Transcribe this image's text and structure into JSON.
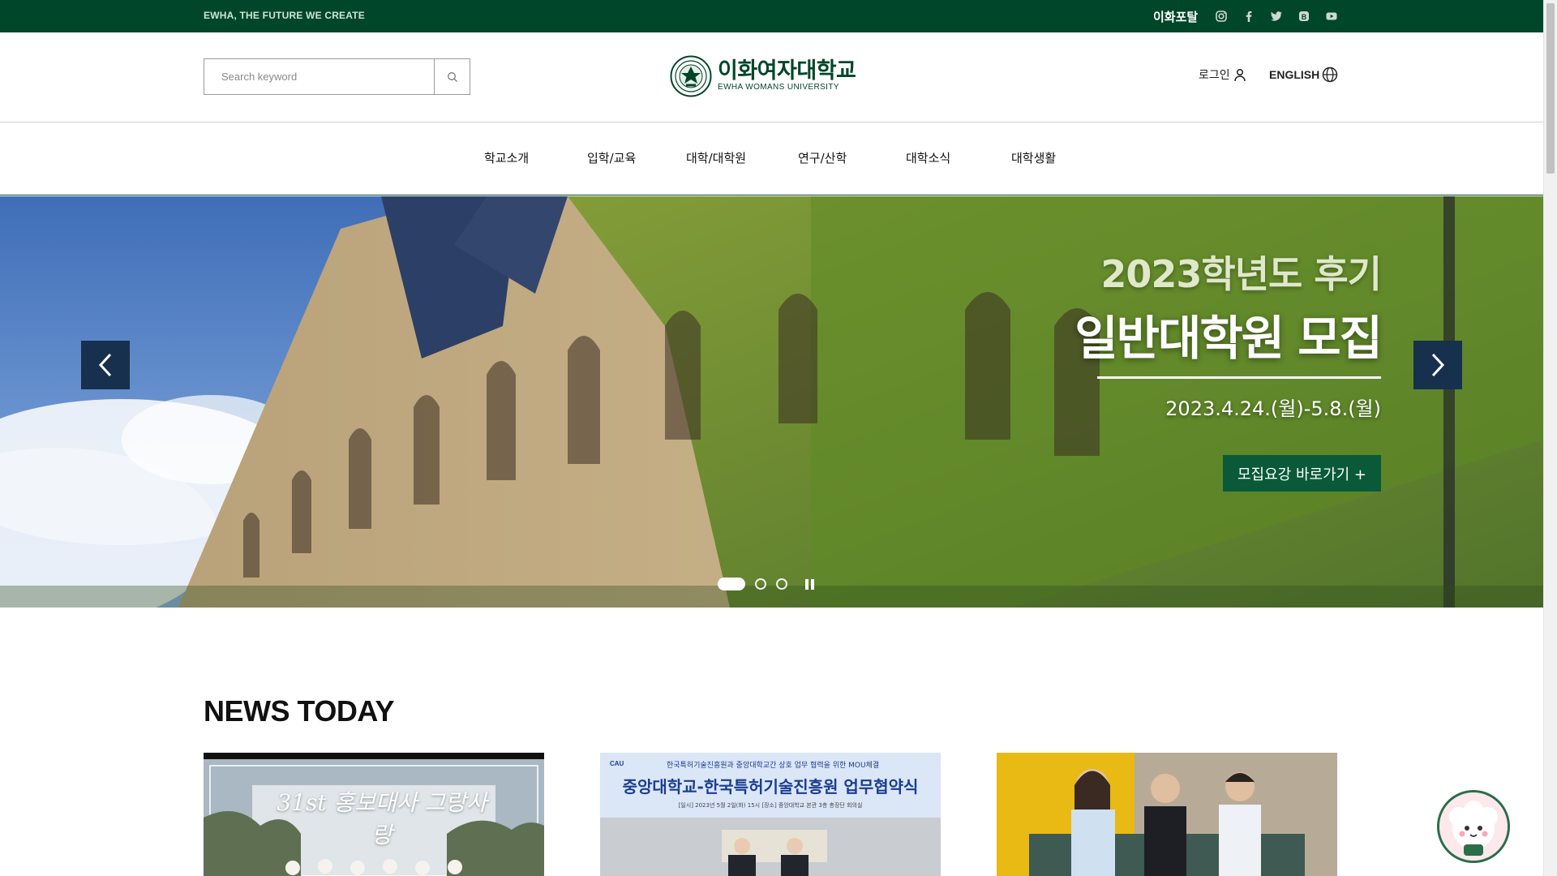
{
  "topbar": {
    "slogan": "EWHA, THE FUTURE WE CREATE",
    "portal": "이화포탈",
    "social": [
      "instagram-icon",
      "facebook-icon",
      "twitter-icon",
      "blog-icon",
      "youtube-icon"
    ]
  },
  "header": {
    "search_placeholder": "Search keyword",
    "logo_ko": "이화여자대학교",
    "logo_en": "EWHA WOMANS UNIVERSITY",
    "login": "로그인",
    "language": "ENGLISH"
  },
  "nav": {
    "items": [
      "학교소개",
      "입학/교육",
      "대학/대학원",
      "연구/산학",
      "대학소식",
      "대학생활"
    ]
  },
  "hero": {
    "caption_line1": "2023학년도 후기",
    "caption_line2": "일반대학원 모집",
    "caption_date": "2023.4.24.(월)-5.8.(월)",
    "cta": "모집요강 바로가기 +",
    "slides_total": 3,
    "active_slide": 1
  },
  "news": {
    "title": "NEWS TODAY",
    "cards": [
      {
        "image": "ambassadors-photo",
        "overlay_text": "31st 홍보대사 그랑사랑"
      },
      {
        "image": "mou-photo",
        "banner_top": "한국특허기술진흥원과 중앙대학교간 상호 업무 협력을 위한 MOU체결",
        "banner_title": "중앙대학교-한국특허기술진흥원 업무협약식",
        "banner_info": "[일시] 2023년 5월 2일(화) 15시  [장소] 중앙대학교 본관 3층 총장단 회의실"
      },
      {
        "image": "interview-photo"
      }
    ]
  },
  "colors": {
    "brand_green": "#00462a",
    "cta_green": "#0a5a3a",
    "arrow_navy": "#17304d"
  }
}
